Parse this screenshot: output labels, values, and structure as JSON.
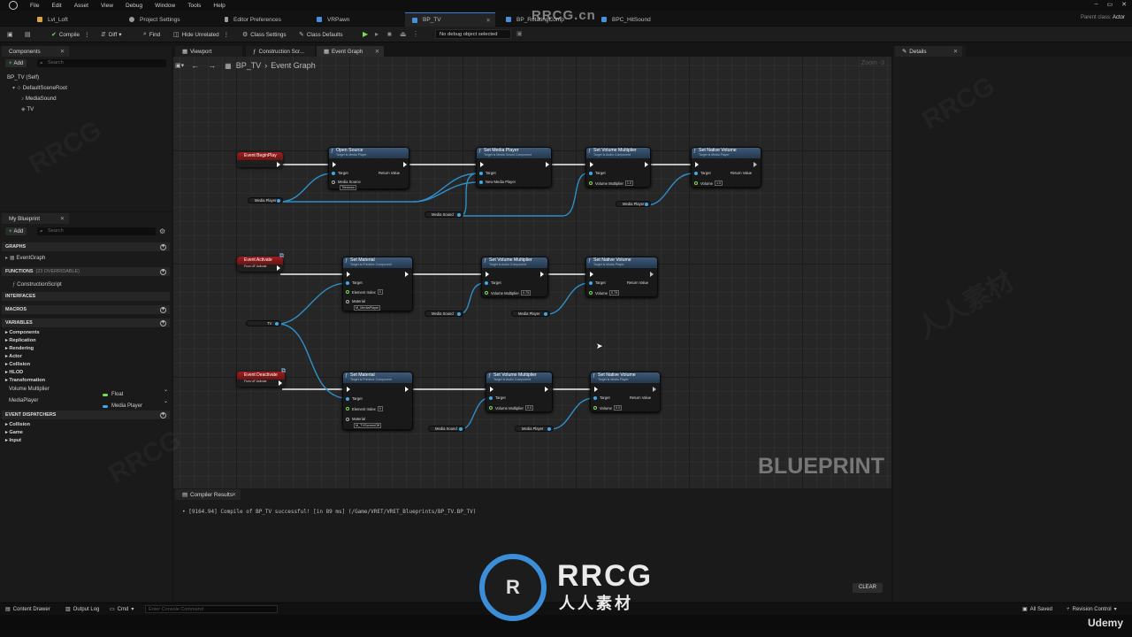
{
  "menu": [
    "File",
    "Edit",
    "Asset",
    "View",
    "Debug",
    "Window",
    "Tools",
    "Help"
  ],
  "window_controls": [
    "–",
    "▭",
    "✕"
  ],
  "tabs": [
    {
      "label": "Lvl_Loft",
      "color": "#d8a640"
    },
    {
      "label": "Project Settings",
      "color": "#9a9a9a"
    },
    {
      "label": "Editor Preferences",
      "color": "#9a9a9a"
    },
    {
      "label": "VRPawn",
      "color": "#4a8fd8"
    },
    {
      "label": "BP_TV",
      "color": "#4a8fd8"
    },
    {
      "label": "BP_RotatingComp",
      "color": "#4a8fd8"
    },
    {
      "label": "BPC_HitSound",
      "color": "#4a8fd8"
    }
  ],
  "parent_class": {
    "label": "Parent class:",
    "value": "Actor"
  },
  "toolbar": {
    "compile": "Compile",
    "diff": "Diff",
    "find": "Find",
    "hide_unrelated": "Hide Unrelated",
    "class_settings": "Class Settings",
    "class_defaults": "Class Defaults",
    "debug_select": "No debug object selected"
  },
  "components_panel": {
    "tab": "Components",
    "add": "Add",
    "search_placeholder": "Search",
    "tree": [
      "BP_TV (Self)",
      "DefaultSceneRoot",
      "MediaSound",
      "TV"
    ]
  },
  "graph_tabs": [
    "Viewport",
    "Construction Scr...",
    "Event Graph"
  ],
  "details_tab": "Details",
  "breadcrumb": {
    "root": "BP_TV",
    "current": "Event Graph"
  },
  "zoom": "Zoom -3",
  "my_blueprint": {
    "tab": "My Blueprint",
    "add": "Add",
    "search_placeholder": "Search",
    "graphs_header": "GRAPHS",
    "graph_item": "EventGraph",
    "functions_header": "FUNCTIONS",
    "functions_count": "(23 OVERRIDABLE)",
    "function_item": "ConstructionScript",
    "interfaces_header": "INTERFACES",
    "macros_header": "MACROS",
    "variables_header": "VARIABLES",
    "categories": [
      "Components",
      "Replication",
      "Rendering",
      "Actor",
      "Collision",
      "HLOD",
      "Transformation"
    ],
    "variables": [
      {
        "name": "Volume Multiplier",
        "type": "Float",
        "color": "#7ed957"
      },
      {
        "name": "MediaPlayer",
        "type": "Media Player",
        "color": "#3fa9e8"
      }
    ],
    "dispatchers_header": "EVENT DISPATCHERS",
    "dispatcher_categories": [
      "Collision",
      "Game",
      "Input"
    ]
  },
  "nodes": {
    "begin_play": "Event BeginPlay",
    "activate": "Event Activate",
    "activate_sub": "From UF Activate",
    "deactivate": "Event Deactivate",
    "deactivate_sub": "From UF Activate",
    "open_source": "Open Source",
    "open_source_sub": "Target is Media Player",
    "set_media_player": "Set Media Player",
    "set_media_player_sub": "Target is Media Sound Component",
    "set_volume_multiplier": "Set Volume Multiplier",
    "set_volume_multiplier_sub": "Target is Audio Component",
    "set_native_volume": "Set Native Volume",
    "set_native_volume_sub": "Target is Media Player",
    "set_material": "Set Material",
    "set_material_sub": "Target is Primitive Component",
    "target": "Target",
    "return_value": "Return Value",
    "media_source": "Media Source",
    "media_source_val": "Tiledown",
    "new_media_player": "New Media Player",
    "volume_multiplier": "Volume Multiplier",
    "volume": "Volume",
    "element_index": "Element Index",
    "material": "Material",
    "val_one": "1.0",
    "val_075": "0.75",
    "val_zero": "0.0",
    "val_elem": "0",
    "mat_on": "M_MediaPlayer",
    "mat_off": "M_TVScreenOff",
    "var_media_player": "Media Player",
    "var_media_sound": "Media Sound",
    "var_tv": "TV"
  },
  "watermark": "BLUEPRINT",
  "compiler": {
    "tab": "Compiler Results",
    "message": "[9164.94] Compile of BP_TV successful! [in 89 ms] (/Game/VRET/VRET_Blueprints/BP_TV.BP_TV)",
    "clear": "CLEAR"
  },
  "statusbar": {
    "content_drawer": "Content Drawer",
    "output_log": "Output Log",
    "cmd": "Cmd",
    "console_placeholder": "Enter Console Command",
    "all_saved": "All Saved",
    "revision_control": "Revision Control"
  },
  "brand": {
    "site": "RRCG.cn",
    "logo_text": "RRCG",
    "cn_text": "人人素材",
    "udemy": "Udemy"
  }
}
